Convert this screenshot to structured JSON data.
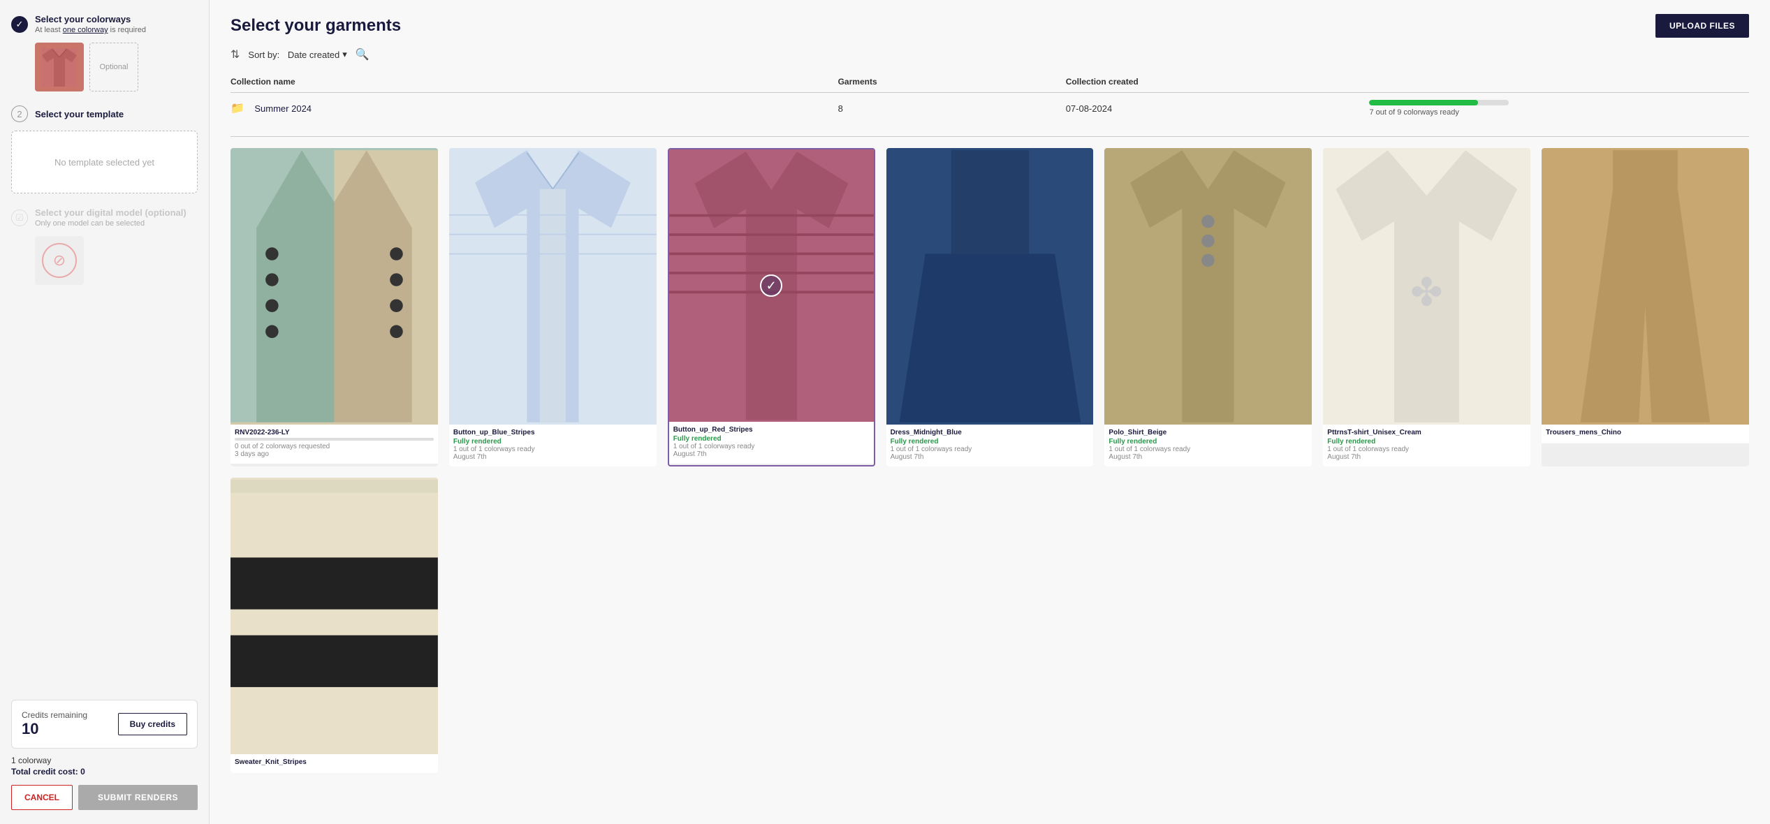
{
  "leftPanel": {
    "step1": {
      "title": "Select your colorways",
      "subtitle": "At least one colorway is required",
      "optionalLabel": "Optional",
      "colorways": [
        {
          "id": "cw1",
          "type": "shirt",
          "color": "#c9756a"
        }
      ]
    },
    "step2": {
      "number": "2",
      "title": "Select your template",
      "noTemplateText": "No template selected yet"
    },
    "step3": {
      "title": "Select your digital model (optional)",
      "subtitle": "Only one model can be selected"
    },
    "credits": {
      "label": "Credits remaining",
      "amount": "10",
      "buyLabel": "Buy credits"
    },
    "colorwayCount": "1 colorway",
    "totalCreditCost": "Total credit cost: 0",
    "cancelLabel": "CANCEL",
    "submitLabel": "SUBMIT RENDERS"
  },
  "rightPanel": {
    "title": "Select your garments",
    "uploadLabel": "UPLOAD FILES",
    "sortLabel": "Sort by:",
    "sortValue": "Date created",
    "collection": {
      "columns": [
        "Collection name",
        "Garments",
        "Collection created"
      ],
      "name": "Summer 2024",
      "garments": "8",
      "date": "07-08-2024",
      "progress": {
        "value": 78,
        "label": "7 out of 9 colorways ready"
      }
    },
    "garments": [
      {
        "id": "g1",
        "name": "RNV2022-236-LY",
        "statusType": "partial",
        "statusText": "",
        "progressText": "0 out of 2 colorways requested",
        "date": "3 days ago",
        "colorClass": "garment-blazer-teal",
        "selected": false
      },
      {
        "id": "g2",
        "name": "Button_up_Blue_Stripes",
        "statusType": "rendered",
        "statusText": "Fully rendered",
        "meta": "1 out of 1 colorways ready",
        "date": "August 7th",
        "colorClass": "garment-shirt-blue",
        "selected": false
      },
      {
        "id": "g3",
        "name": "Button_up_Red_Stripes",
        "statusType": "rendered",
        "statusText": "Fully rendered",
        "meta": "1 out of 1 colorways ready",
        "date": "August 7th",
        "colorClass": "garment-shirt-red",
        "selected": true
      },
      {
        "id": "g4",
        "name": "Dress_Midnight_Blue",
        "statusType": "rendered",
        "statusText": "Fully rendered",
        "meta": "1 out of 1 colorways ready",
        "date": "August 7th",
        "colorClass": "garment-skirt-blue",
        "selected": false
      },
      {
        "id": "g5",
        "name": "Polo_Shirt_Beige",
        "statusType": "rendered",
        "statusText": "Fully rendered",
        "meta": "1 out of 1 colorways ready",
        "date": "August 7th",
        "colorClass": "garment-polo-khaki",
        "selected": false
      },
      {
        "id": "g6",
        "name": "PttrnsT-shirt_Unisex_Cream",
        "statusType": "rendered",
        "statusText": "Fully rendered",
        "meta": "1 out of 1 colorways ready",
        "date": "August 7th",
        "colorClass": "garment-tshirt-cream",
        "selected": false
      },
      {
        "id": "g7",
        "name": "Trousers_mens_Chino",
        "statusType": "partial",
        "statusText": "",
        "meta": "",
        "date": "",
        "colorClass": "garment-trousers-tan",
        "selected": false
      },
      {
        "id": "g8",
        "name": "Sweater_Knit_Stripes",
        "statusType": "partial",
        "statusText": "",
        "meta": "",
        "date": "",
        "colorClass": "garment-sweater-stripe",
        "selected": false
      }
    ]
  }
}
